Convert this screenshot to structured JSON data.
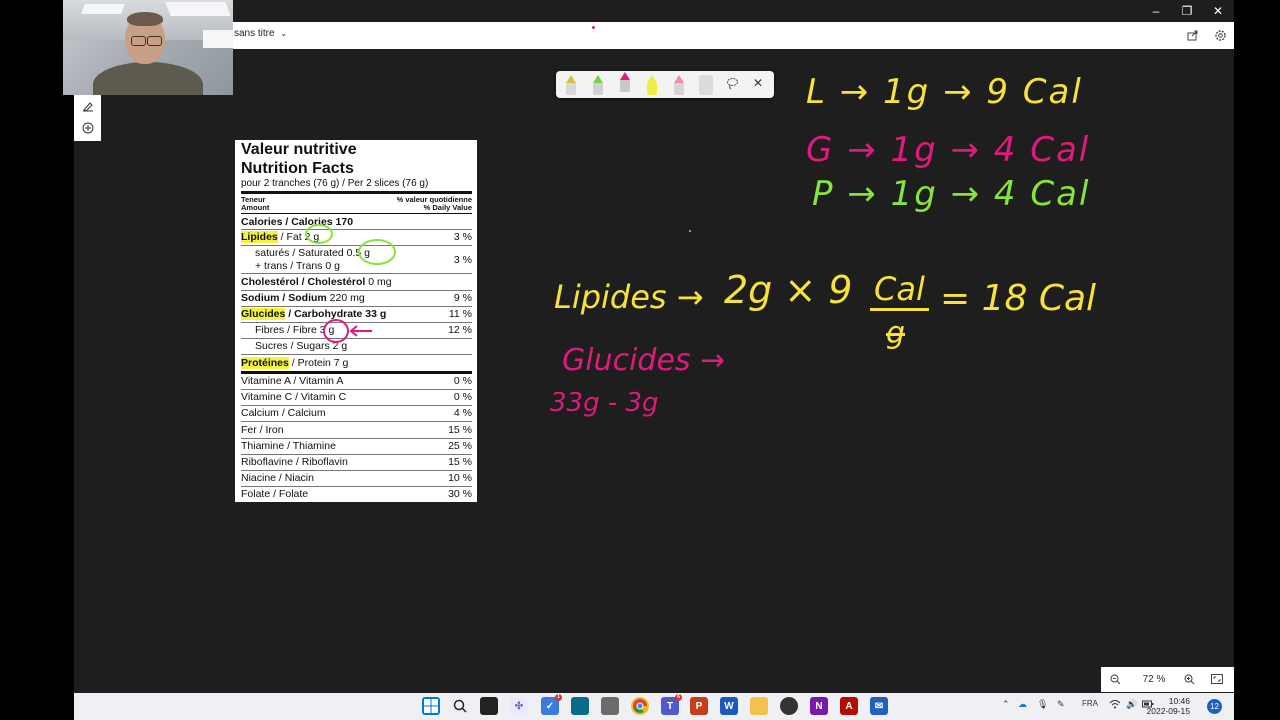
{
  "window": {
    "title": "sans titre",
    "minimize": "–",
    "restore": "❐",
    "close": "✕"
  },
  "colors": {
    "ink_yellow": "#f6e23a",
    "ink_magenta": "#e0197d",
    "ink_green": "#86e43a",
    "label_highlight": "#f4f23f",
    "canvas": "#1e1e1e"
  },
  "nutrition": {
    "title_fr": "Valeur nutritive",
    "title_en": "Nutrition Facts",
    "serving": "pour 2 tranches (76 g) / Per 2 slices (76 g)",
    "teneur": "Teneur",
    "amount": "Amount",
    "dv_fr": "% valeur quotidienne",
    "dv_en": "% Daily Value",
    "calories": "Calories / Calories 170",
    "rows": [
      {
        "pre": "Lipides",
        "rest": " / Fat 2 g",
        "pct": "3 %"
      },
      {
        "label": "saturés / Saturated 0.5 g",
        "label2": "+ trans / Trans 0 g",
        "pct": "3 %"
      },
      {
        "pre": "Cholestérol / Cholestérol",
        "rest": " 0 mg",
        "pct": ""
      },
      {
        "pre": "Sodium / Sodium",
        "rest": " 220 mg",
        "pct": "9 %"
      },
      {
        "pre": "Glucides",
        "rest": " / Carbohydrate 33 g",
        "pct": "11 %"
      },
      {
        "label": "Fibres / Fibre 3 g",
        "pct": "12 %"
      },
      {
        "label": "Sucres / Sugars 2 g",
        "pct": ""
      },
      {
        "pre": "Protéines",
        "rest": " / Protein 7 g",
        "pct": ""
      }
    ],
    "vitamins": [
      {
        "label": "Vitamine A / Vitamin A",
        "pct": "0 %"
      },
      {
        "label": "Vitamine C / Vitamin C",
        "pct": "0 %"
      },
      {
        "label": "Calcium / Calcium",
        "pct": "4 %"
      },
      {
        "label": "Fer / Iron",
        "pct": "15 %"
      },
      {
        "label": "Thiamine / Thiamine",
        "pct": "25 %"
      },
      {
        "label": "Riboflavine / Riboflavin",
        "pct": "15 %"
      },
      {
        "label": "Niacine / Niacin",
        "pct": "10 %"
      },
      {
        "label": "Folate / Folate",
        "pct": "30 %"
      }
    ]
  },
  "notes": {
    "line1": "L → 1g → 9 Cal",
    "line2": "G → 1g → 4 Cal",
    "line3": "P → 1g → 4 Cal",
    "lipides": "Lipides →",
    "calc_a": "2g × 9",
    "calc_unit": "Cal",
    "calc_den": "g",
    "calc_eq": "= 18 Cal",
    "glucides": "Glucides →",
    "glucides_calc": "33g - 3g"
  },
  "palette": {
    "pens": [
      "pencil-yellow",
      "pen-green",
      "pen-magenta",
      "highlighter-yellow",
      "highlighter-pink",
      "eraser"
    ],
    "lasso": "lasso-icon",
    "close": "✕"
  },
  "zoom": {
    "level": "72 %"
  },
  "taskbar": {
    "language": "FRA",
    "time": "10:46",
    "date": "2022-09-15",
    "notifications": "12",
    "teams_badge": "6",
    "todo_badge": "1"
  }
}
